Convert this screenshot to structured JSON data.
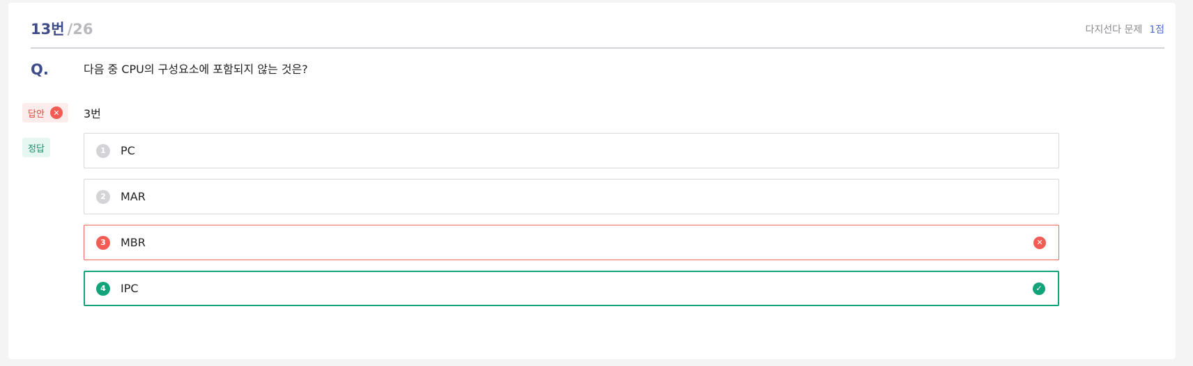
{
  "question": {
    "number": "13번",
    "total": "/26",
    "type": "다지선다 문제",
    "points": "1점",
    "label": "Q.",
    "text": "다음 중 CPU의 구성요소에 포함되지 않는 것은?"
  },
  "answer": {
    "label": "답안",
    "value": "3번"
  },
  "correct": {
    "label": "정답"
  },
  "options": [
    {
      "num": "1",
      "text": "PC",
      "state": "neutral"
    },
    {
      "num": "2",
      "text": "MAR",
      "state": "neutral"
    },
    {
      "num": "3",
      "text": "MBR",
      "state": "wrong"
    },
    {
      "num": "4",
      "text": "IPC",
      "state": "correct"
    }
  ],
  "icons": {
    "wrong": "x-circle-icon",
    "correct": "check-circle-icon"
  },
  "colors": {
    "primary": "#3f4c8a",
    "wrong": "#f25c54",
    "correct": "#12a37a",
    "link": "#4f6bd6"
  }
}
